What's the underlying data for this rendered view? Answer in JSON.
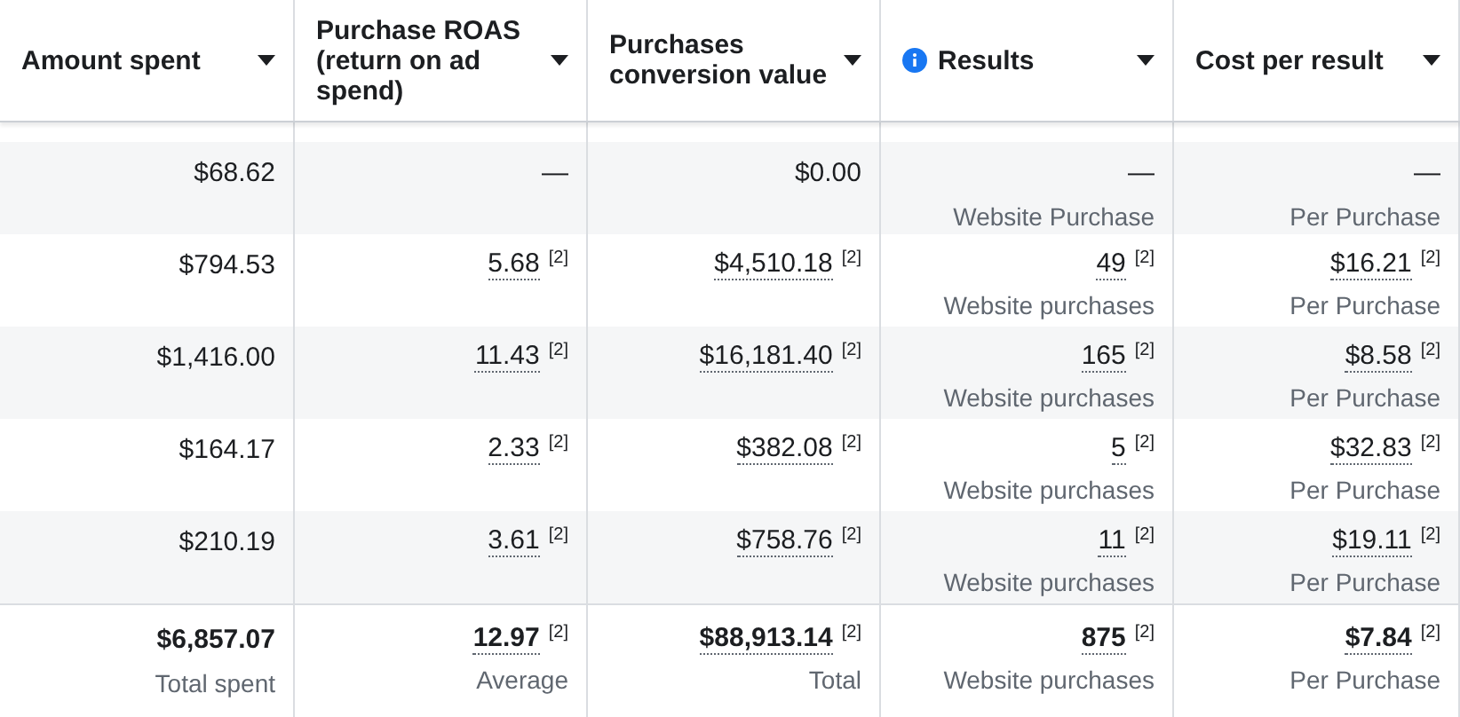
{
  "columns": [
    {
      "title": "Amount spent",
      "info": false
    },
    {
      "title": "Purchase ROAS (return on ad spend)",
      "info": false
    },
    {
      "title": "Purchases conversion value",
      "info": false
    },
    {
      "title": "Results",
      "info": true
    },
    {
      "title": "Cost per result",
      "info": false
    }
  ],
  "rows": [
    {
      "cells": [
        {
          "value": "$68.62"
        },
        {
          "value": "—"
        },
        {
          "value": "$0.00"
        },
        {
          "value": "—",
          "sub": "Website Purchase"
        },
        {
          "value": "—",
          "sub": "Per Purchase"
        }
      ]
    },
    {
      "cells": [
        {
          "value": "$794.53"
        },
        {
          "value": "5.68",
          "note": "[2]"
        },
        {
          "value": "$4,510.18",
          "note": "[2]"
        },
        {
          "value": "49",
          "note": "[2]",
          "sub": "Website purchases"
        },
        {
          "value": "$16.21",
          "note": "[2]",
          "sub": "Per Purchase"
        }
      ]
    },
    {
      "cells": [
        {
          "value": "$1,416.00"
        },
        {
          "value": "11.43",
          "note": "[2]"
        },
        {
          "value": "$16,181.40",
          "note": "[2]"
        },
        {
          "value": "165",
          "note": "[2]",
          "sub": "Website purchases"
        },
        {
          "value": "$8.58",
          "note": "[2]",
          "sub": "Per Purchase"
        }
      ]
    },
    {
      "cells": [
        {
          "value": "$164.17"
        },
        {
          "value": "2.33",
          "note": "[2]"
        },
        {
          "value": "$382.08",
          "note": "[2]"
        },
        {
          "value": "5",
          "note": "[2]",
          "sub": "Website purchases"
        },
        {
          "value": "$32.83",
          "note": "[2]",
          "sub": "Per Purchase"
        }
      ]
    },
    {
      "cells": [
        {
          "value": "$210.19"
        },
        {
          "value": "3.61",
          "note": "[2]"
        },
        {
          "value": "$758.76",
          "note": "[2]"
        },
        {
          "value": "11",
          "note": "[2]",
          "sub": "Website purchases"
        },
        {
          "value": "$19.11",
          "note": "[2]",
          "sub": "Per Purchase"
        }
      ]
    }
  ],
  "totals": [
    {
      "value": "$6,857.07",
      "sub": "Total spent"
    },
    {
      "value": "12.97",
      "note": "[2]",
      "sub": "Average"
    },
    {
      "value": "$88,913.14",
      "note": "[2]",
      "sub": "Total"
    },
    {
      "value": "875",
      "note": "[2]",
      "sub": "Website purchases"
    },
    {
      "value": "$7.84",
      "note": "[2]",
      "sub": "Per Purchase"
    }
  ]
}
